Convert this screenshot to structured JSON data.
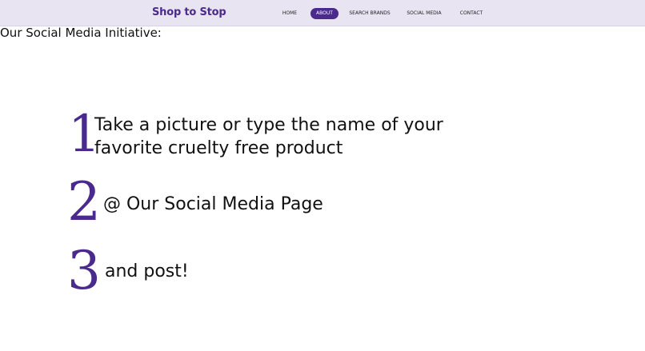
{
  "nav": {
    "brand": "Shop to Stop",
    "items": [
      {
        "label": "HOME",
        "active": false
      },
      {
        "label": "ABOUT",
        "active": true
      },
      {
        "label": "SEARCH BRANDS",
        "active": false
      },
      {
        "label": "SOCIAL MEDIA",
        "active": false
      },
      {
        "label": "CONTACT",
        "active": false
      }
    ],
    "active_color": "#4a2a8c"
  },
  "main": {
    "title": "Our Social Media Initiative:",
    "steps": [
      {
        "number": "1",
        "text": "Take a picture or type the name of your favorite cruelty free product"
      },
      {
        "number": "2",
        "text": "@ Our Social Media Page"
      },
      {
        "number": "3",
        "text": "and post!"
      }
    ],
    "accent_color": "#4a2a8c"
  }
}
